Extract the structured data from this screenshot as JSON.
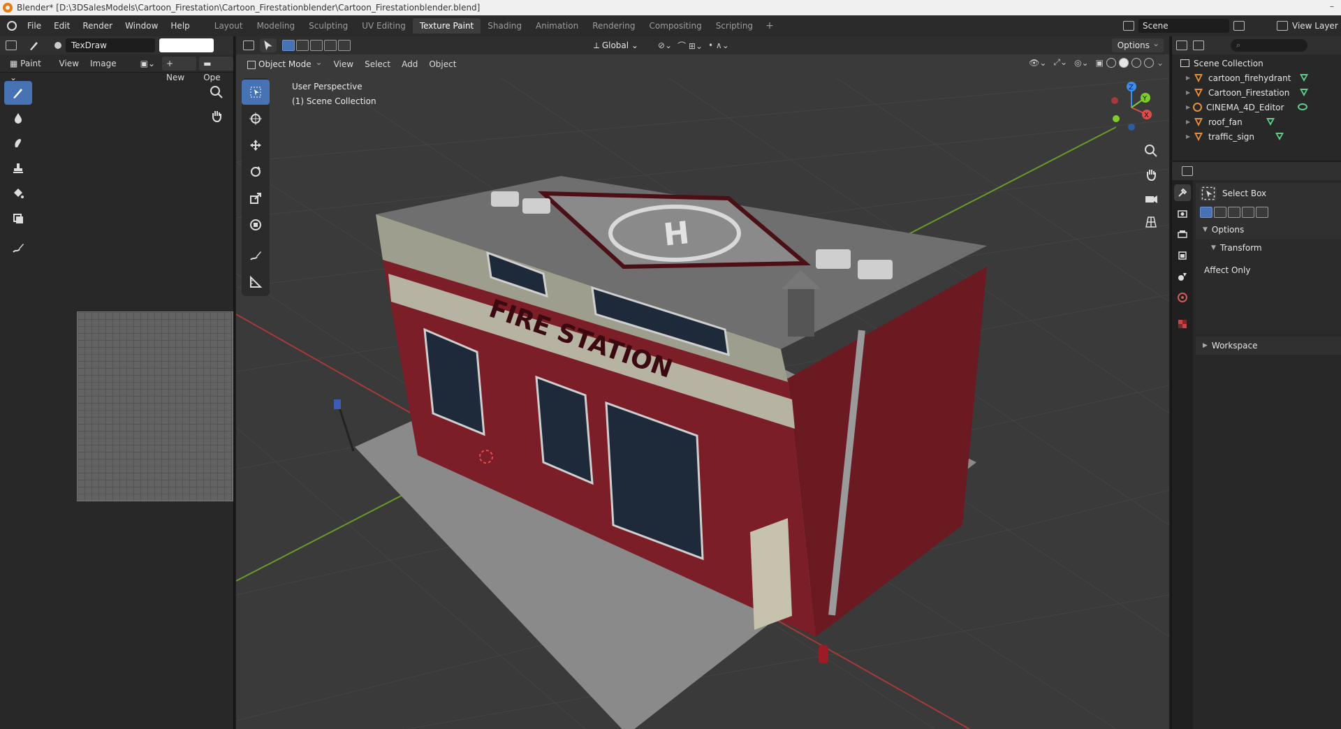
{
  "window": {
    "title": "Blender* [D:\\3DSalesModels\\Cartoon_Firestation\\Cartoon_Firestationblender\\Cartoon_Firestationblender.blend]",
    "minimize_glyph": "–"
  },
  "menubar": {
    "items": [
      "File",
      "Edit",
      "Render",
      "Window",
      "Help"
    ],
    "workspaces": [
      "Layout",
      "Modeling",
      "Sculpting",
      "UV Editing",
      "Texture Paint",
      "Shading",
      "Animation",
      "Rendering",
      "Compositing",
      "Scripting"
    ],
    "active_workspace": "Texture Paint",
    "add_glyph": "+",
    "scene_name": "Scene",
    "view_layer": "View Layer"
  },
  "image_editor": {
    "brush_name": "TexDraw",
    "mode_label": "Paint",
    "menus": [
      "View",
      "Image"
    ],
    "new_label": "New",
    "open_label": "Ope",
    "color_swatch": "#ffffff"
  },
  "viewport": {
    "mode": "Object Mode",
    "menus": [
      "View",
      "Select",
      "Add",
      "Object"
    ],
    "transform_orientation": "Global",
    "options_label": "Options",
    "perspective_label": "User Perspective",
    "collection_label": "(1) Scene Collection",
    "building_sign": "FIRE STATION",
    "helipad_letter": "H",
    "gizmo_labels": {
      "z": "Z",
      "y": "Y",
      "x": "X"
    },
    "axis_colors": {
      "x": "#e04b4b",
      "y": "#7fcc2d",
      "z": "#3e8df0"
    }
  },
  "outliner": {
    "root": "Scene Collection",
    "objects": [
      {
        "name": "cartoon_firehydrant",
        "icon": "mesh-icon",
        "data_icon": "mesh-data-icon"
      },
      {
        "name": "Cartoon_Firestation",
        "icon": "mesh-icon",
        "data_icon": "mesh-data-icon"
      },
      {
        "name": "CINEMA_4D_Editor",
        "icon": "empty-icon",
        "data_icon": "group-data-icon"
      },
      {
        "name": "roof_fan",
        "icon": "mesh-icon",
        "data_icon": "mesh-data-icon"
      },
      {
        "name": "traffic_sign",
        "icon": "mesh-icon",
        "data_icon": "mesh-data-icon"
      }
    ]
  },
  "properties": {
    "active_tool": "Select Box",
    "options_label": "Options",
    "transform_label": "Transform",
    "affect_only_label": "Affect Only",
    "workspace_label": "Workspace"
  }
}
